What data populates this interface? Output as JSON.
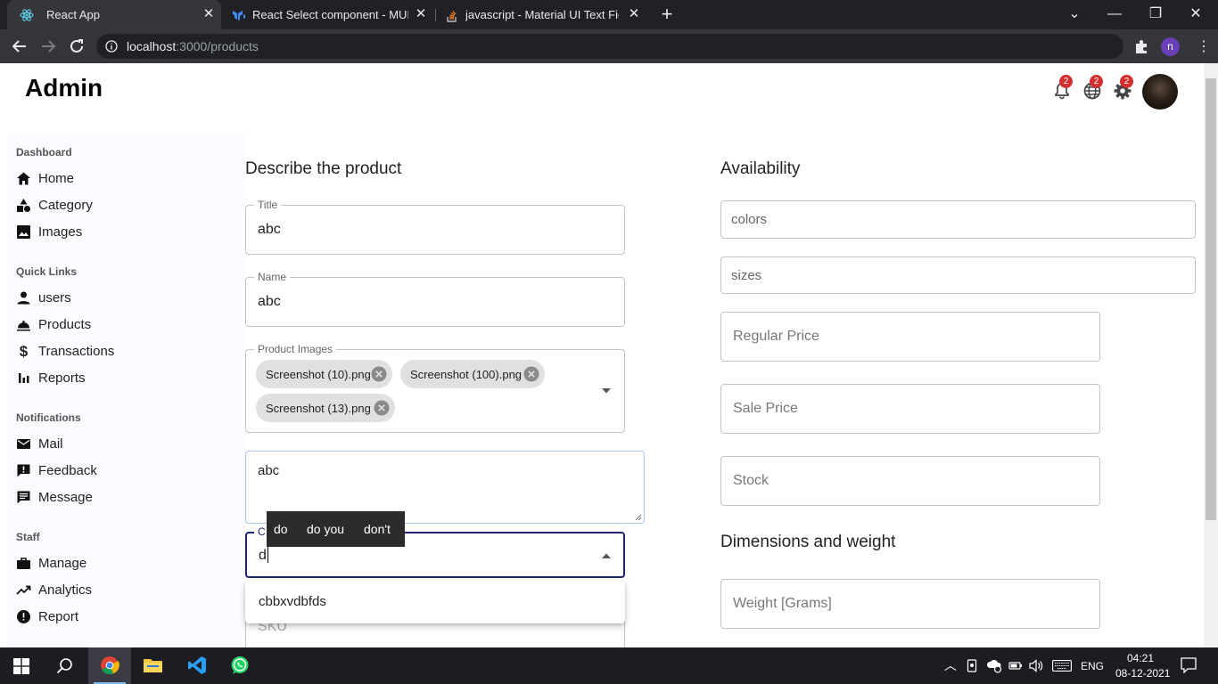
{
  "browser": {
    "tabs": [
      {
        "label": "React App",
        "active": true,
        "icon": "react-icon"
      },
      {
        "label": "React Select component - MUI",
        "active": false,
        "icon": "mui-icon"
      },
      {
        "label": "javascript - Material UI Text Field",
        "active": false,
        "icon": "stackoverflow-icon"
      }
    ],
    "url_host": "localhost",
    "url_path": ":3000/products",
    "profile_initial": "n"
  },
  "header": {
    "title": "Admin",
    "notifications_count": "2",
    "language_count": "2",
    "settings_count": "2"
  },
  "sidebar": {
    "sections": [
      {
        "title": "Dashboard",
        "items": [
          {
            "label": "Home",
            "icon": "home-icon"
          },
          {
            "label": "Category",
            "icon": "category-icon"
          },
          {
            "label": "Images",
            "icon": "image-icon"
          }
        ]
      },
      {
        "title": "Quick Links",
        "items": [
          {
            "label": "users",
            "icon": "person-icon"
          },
          {
            "label": "Products",
            "icon": "products-icon"
          },
          {
            "label": "Transactions",
            "icon": "dollar-icon"
          },
          {
            "label": "Reports",
            "icon": "bar-chart-icon"
          }
        ]
      },
      {
        "title": "Notifications",
        "items": [
          {
            "label": "Mail",
            "icon": "mail-icon"
          },
          {
            "label": "Feedback",
            "icon": "feedback-icon"
          },
          {
            "label": "Message",
            "icon": "message-icon"
          }
        ]
      },
      {
        "title": "Staff",
        "items": [
          {
            "label": "Manage",
            "icon": "briefcase-icon"
          },
          {
            "label": "Analytics",
            "icon": "trending-up-icon"
          },
          {
            "label": "Report",
            "icon": "report-icon"
          }
        ]
      }
    ]
  },
  "form": {
    "describe_heading": "Describe the product",
    "title_label": "Title",
    "title_value": "abc",
    "name_label": "Name",
    "name_value": "abc",
    "images_label": "Product Images",
    "images": [
      "Screenshot (10).png",
      "Screenshot (100).png",
      "Screenshot (13).png"
    ],
    "description_value": "abc",
    "category_label": "C",
    "category_value": "d",
    "category_option": "cbbxvdbfds",
    "sku_placeholder": "SKU",
    "suggestions": [
      "do",
      "do you",
      "don't"
    ]
  },
  "availability": {
    "heading": "Availability",
    "colors_placeholder": "colors",
    "sizes_placeholder": "sizes",
    "regular_price_placeholder": "Regular Price",
    "sale_price_placeholder": "Sale Price",
    "stock_placeholder": "Stock"
  },
  "dimensions": {
    "heading": "Dimensions and weight",
    "weight_placeholder": "Weight [Grams]"
  },
  "taskbar": {
    "language": "ENG",
    "time": "04:21",
    "date": "08-12-2021"
  },
  "colors": {
    "accent": "#1a237e",
    "badge": "#d32f2f"
  }
}
